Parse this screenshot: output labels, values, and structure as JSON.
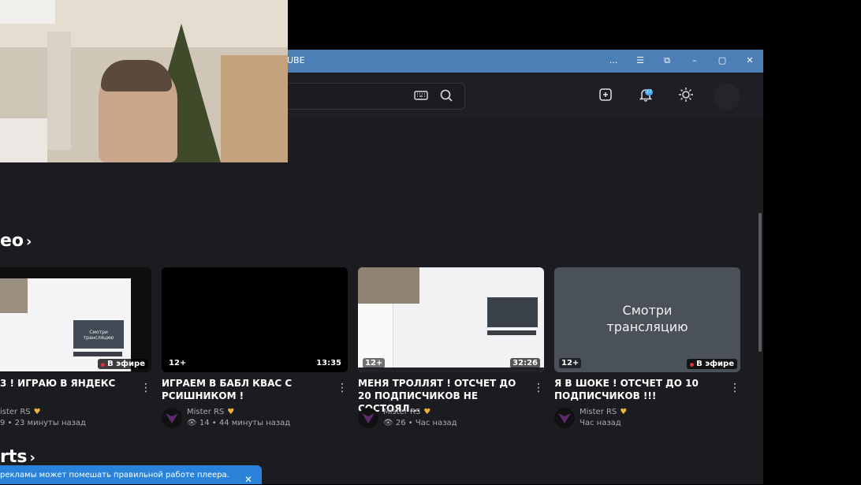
{
  "window": {
    "title": "UBE",
    "controls": [
      "...",
      "☰",
      "⧉",
      "–",
      "▢",
      "✕"
    ]
  },
  "header": {
    "icons": [
      "keyboard-icon",
      "search-icon",
      "add-icon",
      "bell-icon",
      "sun-icon"
    ],
    "notification_count": "37"
  },
  "sections": {
    "videos_label": "eo",
    "shorts_label": "rts"
  },
  "videos": [
    {
      "title": "3 ! ИГРАЮ В ЯНДЕКС",
      "channel": "ister RS",
      "views": "9",
      "time": "23 минуты назад",
      "badge_live": "В эфире",
      "age": ""
    },
    {
      "title": "ИГРАЕМ В БАБЛ КВАС С РСИШНИКОМ !",
      "channel": "Mister RS",
      "views": "14",
      "time": "44 минуты назад",
      "age": "12+",
      "duration": "13:35"
    },
    {
      "title": "МЕНЯ ТРОЛЛЯТ ! ОТСЧЕТ ДО 20 ПОДПИСЧИКОВ НЕ СОСТОЯЛ...",
      "channel": "Mister RS",
      "views": "26",
      "time": "Час назад",
      "age": "12+",
      "duration": "32:26"
    },
    {
      "title": "Я В ШОКЕ ! ОТСЧЕТ ДО 10 ПОДПИСЧИКОВ !!!",
      "channel": "Mister RS",
      "time": "Час назад",
      "age": "12+",
      "badge_live": "В эфире",
      "thumb_text": "Смотри трансляцию"
    }
  ],
  "notice": {
    "text": "рекламы может помешать правильной работе плеера.",
    "close": "✕"
  },
  "colors": {
    "titlebar": "#4b7fb6",
    "background": "#1b1c20",
    "live_dot": "#e0303a",
    "notice": "#2b82d9"
  }
}
